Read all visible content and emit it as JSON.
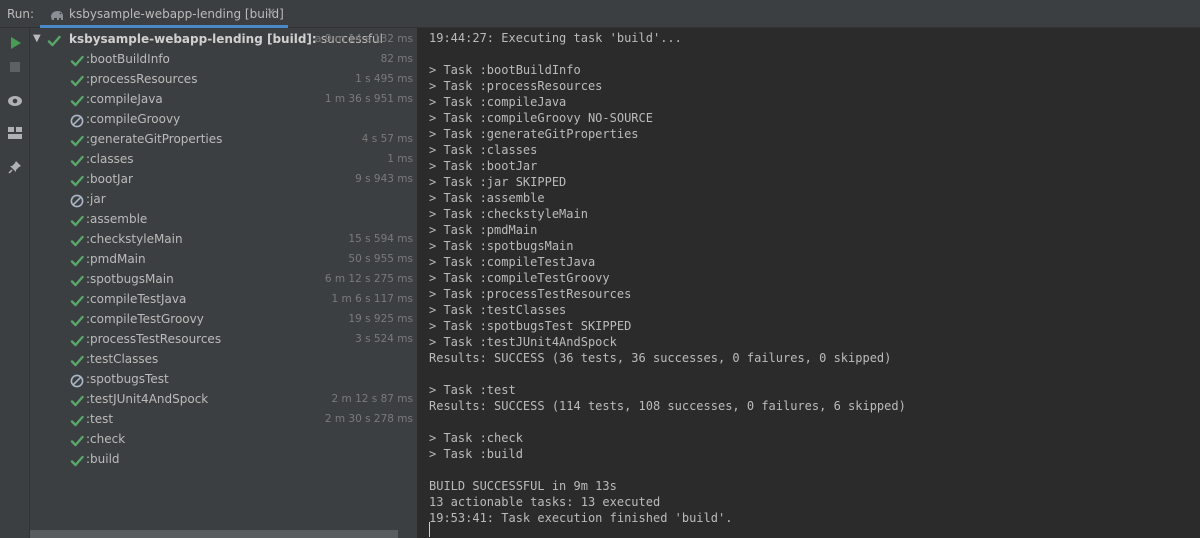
{
  "toolbar": {
    "run_label": "Run:"
  },
  "tab": {
    "title": "ksbysample-webapp-lending [build]",
    "close_glyph": "×",
    "icon": "gradle-elephant-icon"
  },
  "side_actions": [
    {
      "name": "rerun-icon"
    },
    {
      "name": "stop-icon"
    },
    {
      "name": "toggle-view-icon"
    },
    {
      "name": "layout-icon"
    },
    {
      "name": "pin-icon"
    }
  ],
  "tree": {
    "root": {
      "label": "ksbysample-webapp-lending [build]:",
      "result": "successful",
      "duration": "a 9 m 14 s 132 ms"
    },
    "tasks": [
      {
        "label": ":bootBuildInfo",
        "status": "success",
        "duration": "82 ms"
      },
      {
        "label": ":processResources",
        "status": "success",
        "duration": "1 s 495 ms"
      },
      {
        "label": ":compileJava",
        "status": "success",
        "duration": "1 m 36 s 951 ms"
      },
      {
        "label": ":compileGroovy",
        "status": "skipped",
        "duration": ""
      },
      {
        "label": ":generateGitProperties",
        "status": "success",
        "duration": "4 s 57 ms"
      },
      {
        "label": ":classes",
        "status": "success",
        "duration": "1 ms"
      },
      {
        "label": ":bootJar",
        "status": "success",
        "duration": "9 s 943 ms"
      },
      {
        "label": ":jar",
        "status": "skipped",
        "duration": ""
      },
      {
        "label": ":assemble",
        "status": "success",
        "duration": ""
      },
      {
        "label": ":checkstyleMain",
        "status": "success",
        "duration": "15 s 594 ms"
      },
      {
        "label": ":pmdMain",
        "status": "success",
        "duration": "50 s 955 ms"
      },
      {
        "label": ":spotbugsMain",
        "status": "success",
        "duration": "6 m 12 s 275 ms"
      },
      {
        "label": ":compileTestJava",
        "status": "success",
        "duration": "1 m 6 s 117 ms"
      },
      {
        "label": ":compileTestGroovy",
        "status": "success",
        "duration": "19 s 925 ms"
      },
      {
        "label": ":processTestResources",
        "status": "success",
        "duration": "3 s 524 ms"
      },
      {
        "label": ":testClasses",
        "status": "success",
        "duration": ""
      },
      {
        "label": ":spotbugsTest",
        "status": "skipped",
        "duration": ""
      },
      {
        "label": ":testJUnit4AndSpock",
        "status": "success",
        "duration": "2 m 12 s 87 ms"
      },
      {
        "label": ":test",
        "status": "success",
        "duration": "2 m 30 s 278 ms"
      },
      {
        "label": ":check",
        "status": "success",
        "duration": ""
      },
      {
        "label": ":build",
        "status": "success",
        "duration": ""
      }
    ]
  },
  "console": {
    "lines": [
      "19:44:27: Executing task 'build'...",
      "",
      "> Task :bootBuildInfo",
      "> Task :processResources",
      "> Task :compileJava",
      "> Task :compileGroovy NO-SOURCE",
      "> Task :generateGitProperties",
      "> Task :classes",
      "> Task :bootJar",
      "> Task :jar SKIPPED",
      "> Task :assemble",
      "> Task :checkstyleMain",
      "> Task :pmdMain",
      "> Task :spotbugsMain",
      "> Task :compileTestJava",
      "> Task :compileTestGroovy",
      "> Task :processTestResources",
      "> Task :testClasses",
      "> Task :spotbugsTest SKIPPED",
      "> Task :testJUnit4AndSpock",
      "Results: SUCCESS (36 tests, 36 successes, 0 failures, 0 skipped)",
      "",
      "> Task :test",
      "Results: SUCCESS (114 tests, 108 successes, 0 failures, 6 skipped)",
      "",
      "> Task :check",
      "> Task :build",
      "",
      "BUILD SUCCESSFUL in 9m 13s",
      "13 actionable tasks: 13 executed",
      "19:53:41: Task execution finished 'build'."
    ]
  },
  "colors": {
    "success": "#59a869",
    "skipped": "#a9b7c6",
    "accent": "#4a88c7",
    "run": "#499c54"
  }
}
